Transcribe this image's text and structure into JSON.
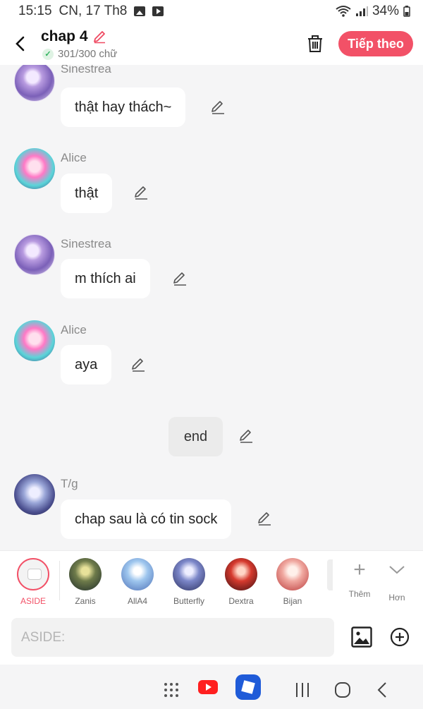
{
  "status_bar": {
    "time": "15:15",
    "date": "CN, 17 Th8",
    "battery": "34%"
  },
  "header": {
    "title": "chap 4",
    "word_count": "301/300 chữ",
    "next_button": "Tiếp theo"
  },
  "messages": [
    {
      "sender": "Sinestrea",
      "text": "thật hay thách~"
    },
    {
      "sender": "Alice",
      "text": "thật"
    },
    {
      "sender": "Sinestrea",
      "text": "m thích ai"
    },
    {
      "sender": "Alice",
      "text": "aya"
    },
    {
      "sender": "",
      "text": "end"
    },
    {
      "sender": "T/g",
      "text": "chap sau là có tin sock"
    }
  ],
  "characters": [
    {
      "name": "ASIDE"
    },
    {
      "name": "Zanis"
    },
    {
      "name": "AllA4"
    },
    {
      "name": "Butterfly"
    },
    {
      "name": "Dextra"
    },
    {
      "name": "Bijan"
    }
  ],
  "char_actions": {
    "more": "Thêm",
    "expand": "Hơn"
  },
  "input": {
    "placeholder": "ASIDE:"
  },
  "colors": {
    "accent": "#f25167",
    "bubble": "#ffffff",
    "background": "#f5f5f6"
  }
}
